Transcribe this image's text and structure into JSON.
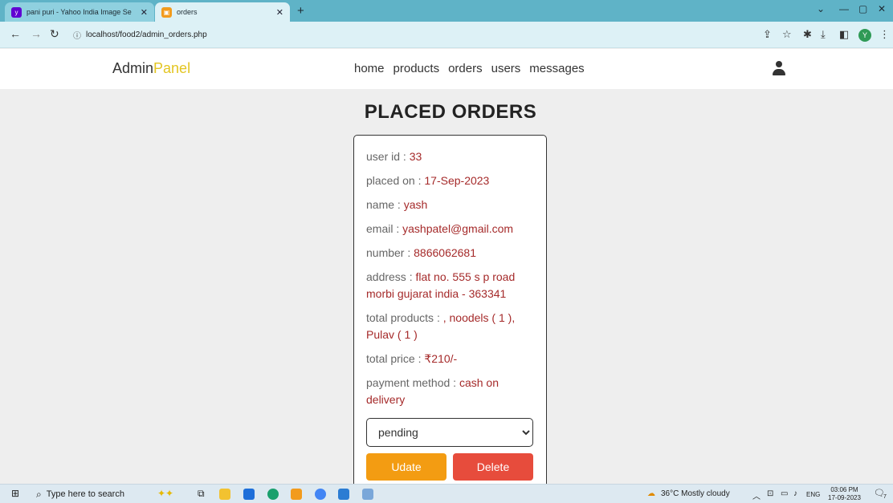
{
  "browser": {
    "tabs": [
      {
        "title": "pani puri - Yahoo India Image Se",
        "favicon": "yahoo-favicon",
        "active": false
      },
      {
        "title": "orders",
        "favicon": "orders-favicon",
        "active": true
      }
    ],
    "url": "localhost/food2/admin_orders.php",
    "profile_initial": "Y",
    "colors": {
      "tabbar": "#5fb3c7",
      "addressbar": "#ddf1f6"
    }
  },
  "header": {
    "logo_main": "Admin",
    "logo_accent": "Panel",
    "nav": [
      "home",
      "products",
      "orders",
      "users",
      "messages"
    ],
    "logo_accent_color": "#e3c521"
  },
  "page": {
    "title": "PLACED ORDERS"
  },
  "order": {
    "fields": [
      {
        "label": "user id : ",
        "value": "33"
      },
      {
        "label": "placed on : ",
        "value": "17-Sep-2023"
      },
      {
        "label": "name : ",
        "value": "yash"
      },
      {
        "label": "email : ",
        "value": "yashpatel@gmail.com"
      },
      {
        "label": "number : ",
        "value": "8866062681"
      },
      {
        "label": "address : ",
        "value": "flat no. 555 s p road morbi gujarat india - 363341"
      },
      {
        "label": "total products : ",
        "value": ", noodels ( 1 ), Pulav ( 1 )"
      },
      {
        "label": "total price : ",
        "value": "₹210/-"
      },
      {
        "label": "payment method : ",
        "value": "cash on delivery"
      }
    ],
    "status_selected": "pending",
    "update_label": "Udate",
    "delete_label": "Delete",
    "value_color": "#a52a2a",
    "update_color": "#f39c12",
    "delete_color": "#e74c3c"
  },
  "taskbar": {
    "search_placeholder": "Type here to search",
    "weather": "36°C  Mostly cloudy",
    "language": "ENG",
    "time": "03:06 PM",
    "date": "17-09-2023",
    "notification_count": "7"
  }
}
